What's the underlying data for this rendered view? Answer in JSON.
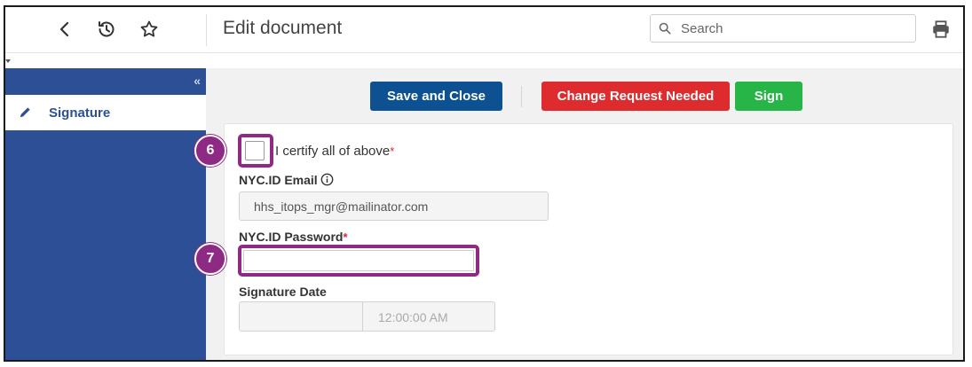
{
  "header": {
    "title": "Edit document",
    "search_placeholder": "Search",
    "icons": [
      "chevron-left-icon",
      "history-icon",
      "star-icon",
      "search-icon",
      "print-icon"
    ]
  },
  "sidebar": {
    "collapse_glyph": "«",
    "items": [
      {
        "label": "Signature",
        "icon": "pencil-icon",
        "active": true
      }
    ]
  },
  "toolbar": {
    "save_close_label": "Save and Close",
    "change_request_label": "Change Request Needed",
    "sign_label": "Sign"
  },
  "form": {
    "certify_label": "I certify all of above",
    "required_marker": "*",
    "email_label": "NYC.ID Email",
    "email_value": "hhs_itops_mgr@mailinator.com",
    "password_label": "NYC.ID Password",
    "password_value": "",
    "signature_date_label": "Signature Date",
    "signature_date_value": "",
    "signature_time_value": "12:00:00 AM"
  },
  "annotations": {
    "step_6": "6",
    "step_7": "7"
  },
  "colors": {
    "sidebar_bg": "#2c4f96",
    "save_button": "#0e5193",
    "change_request_button": "#dd2b2e",
    "sign_button": "#28b548",
    "highlight": "#8e2a83",
    "required": "#d9262b"
  }
}
